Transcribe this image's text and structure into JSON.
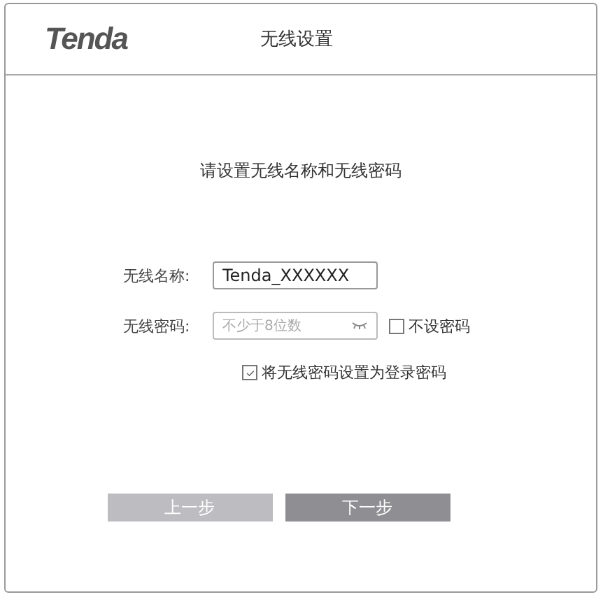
{
  "header": {
    "logo": "Tenda",
    "title": "无线设置"
  },
  "heading": "请设置无线名称和无线密码",
  "ssid": {
    "label": "无线名称:",
    "value": "Tenda_XXXXXX"
  },
  "password": {
    "label": "无线密码:",
    "placeholder": "不少于8位数",
    "no_password": {
      "label": "不设密码",
      "checked": false
    }
  },
  "same_as_login": {
    "label": "将无线密码设置为登录密码",
    "checked": true
  },
  "buttons": [
    {
      "label": "上一步",
      "disabled": true
    },
    {
      "label": "下一步",
      "disabled": false
    }
  ]
}
